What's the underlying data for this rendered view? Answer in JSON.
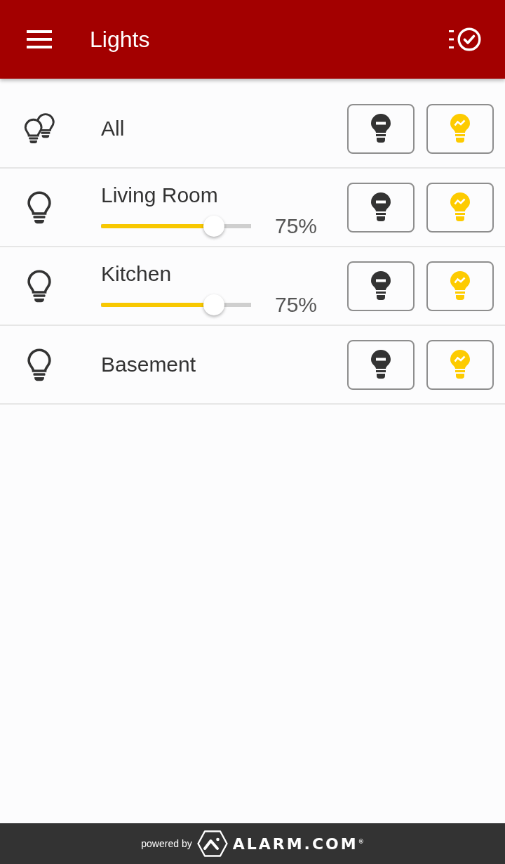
{
  "app_bar": {
    "title": "Lights"
  },
  "lights": [
    {
      "kind": "group",
      "name": "All"
    },
    {
      "kind": "dimmer",
      "name": "Living Room",
      "level": 0.75,
      "reading": "75%"
    },
    {
      "kind": "dimmer",
      "name": "Kitchen",
      "level": 0.75,
      "reading": "75%"
    },
    {
      "kind": "switch",
      "name": "Basement"
    }
  ],
  "footer": {
    "powered_by": "powered by",
    "brand": "ALARM.COM$^{®}$"
  }
}
